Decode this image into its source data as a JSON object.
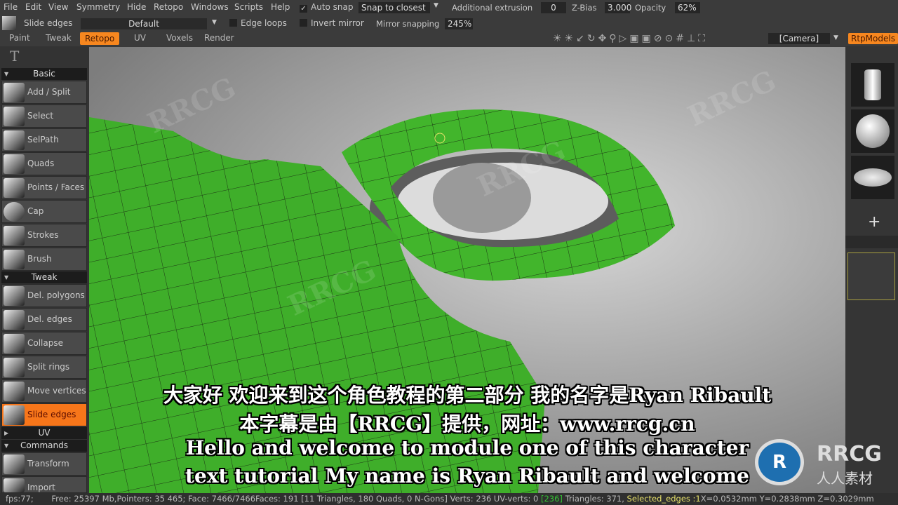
{
  "menu": [
    "File",
    "Edit",
    "View",
    "Symmetry",
    "Hide",
    "Retopo",
    "Windows",
    "Scripts",
    "Help"
  ],
  "toolbar": {
    "auto_snap_label": "Auto snap",
    "auto_snap_checked": true,
    "snap_mode": "Snap to closest",
    "additional_extrusion_label": "Additional extrusion",
    "additional_extrusion": "0",
    "zbias_label": "Z-Bias",
    "zbias": "3.000",
    "opacity_label": "Opacity",
    "opacity": "62%",
    "current_tool": "Slide edges",
    "preset": "Default",
    "edge_loops_label": "Edge loops",
    "invert_mirror_label": "Invert mirror",
    "mirror_snapping_label": "Mirror snapping",
    "mirror_snapping": "245%",
    "camera": "[Camera]"
  },
  "tabs": [
    "Paint",
    "Tweak",
    "Retopo",
    "UV",
    "Voxels",
    "Render"
  ],
  "active_tab": "Retopo",
  "right_tab": "RtpModels",
  "left_panel": {
    "sections": {
      "basic": "Basic",
      "tweak": "Tweak",
      "uv": "UV",
      "commands": "Commands"
    },
    "basic_tools": [
      "Add / Split",
      "Select",
      "SelPath",
      "Quads",
      "Points / Faces",
      "Cap",
      "Strokes",
      "Brush"
    ],
    "tweak_tools": [
      "Del. polygons",
      "Del. edges",
      "Collapse",
      "Split rings",
      "Move vertices",
      "Slide edges"
    ],
    "command_tools": [
      "Transform",
      "Import"
    ],
    "active_tool": "Slide edges"
  },
  "status": {
    "fps": "fps:77;",
    "info": "Free: 25397 Mb,Pointers: 35 465; Face: 7466/7466Faces: 191 [11 Triangles, 180  Quads, 0 N-Gons] Verts: 236  UV-verts: 0",
    "uv_count": "[236]",
    "triangles": "Triangles: 371,",
    "selected": "Selected_edges :1",
    "coords": "X=0.0532mm Y=0.2838mm Z=0.3029mm"
  },
  "subtitles": [
    "大家好 欢迎来到这个角色教程的第二部分 我的名字是Ryan Ribault",
    "本字幕是由【RRCG】提供，网址：www.rrcg.cn",
    "Hello and welcome to module one of this character",
    "text tutorial My name is Ryan Ribault and welcome"
  ],
  "watermark": {
    "logo": "RRCG",
    "sub": "人人素材"
  },
  "colors": {
    "accent": "#f7871f",
    "mesh": "#3fbf2a",
    "status_uv": "#35c435",
    "status_selected": "#e8e26a"
  }
}
